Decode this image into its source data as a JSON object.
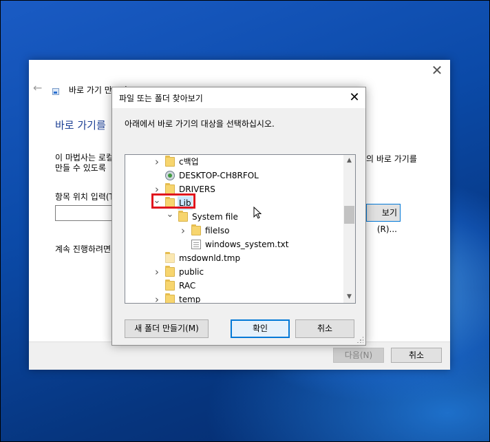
{
  "wizard": {
    "title": "바로 가기 만드기",
    "heading": "바로 가기를",
    "description_left": "이 마법사는 로컬 또는 네트워크 프로그램, 파일, 폴더, 컴퓨터 또는 인터넷 주소에 대한 바로 가기를 만들 수 있도록",
    "description_line2": "만들 수 있도록",
    "description_right": "의 바로 가기를",
    "location_label": "항목 위치 입력(T):",
    "location_value": "",
    "browse_label": "보기(R)...",
    "continue_text": "계속 진행하려면 [다음]을 클릭하십시오.",
    "next_label": "다음(N)",
    "cancel_label": "취소"
  },
  "dialog": {
    "title": "파일 또는 폴더 찾아보기",
    "instruction": "아래에서 바로 가기의 대상을 선택하십시오.",
    "tree": [
      {
        "label": "c백업",
        "icon": "folder-icon",
        "expander": "collapsed",
        "level": 0
      },
      {
        "label": "DESKTOP-CH8RFOL",
        "icon": "computer-icon",
        "expander": "none",
        "level": 0
      },
      {
        "label": "DRIVERS",
        "icon": "folder-icon",
        "expander": "collapsed",
        "level": 0
      },
      {
        "label": "Lib",
        "icon": "folder-icon",
        "expander": "expanded",
        "level": 0,
        "selected": true
      },
      {
        "label": "System file",
        "icon": "folder-icon",
        "expander": "expanded",
        "level": 1
      },
      {
        "label": "fileIso",
        "icon": "folder-icon",
        "expander": "collapsed",
        "level": 2
      },
      {
        "label": "windows_system.txt",
        "icon": "file-icon",
        "expander": "none",
        "level": 2
      },
      {
        "label": "msdownld.tmp",
        "icon": "folder-pale-icon",
        "expander": "none",
        "level": 0
      },
      {
        "label": "public",
        "icon": "folder-icon",
        "expander": "collapsed",
        "level": 0
      },
      {
        "label": "RAC",
        "icon": "folder-icon",
        "expander": "none",
        "level": 0
      },
      {
        "label": "temp",
        "icon": "folder-icon",
        "expander": "collapsed",
        "level": 0
      }
    ],
    "new_folder_label": "새 폴더 만들기(M)",
    "ok_label": "확인",
    "cancel_label": "취소"
  },
  "colors": {
    "highlight_box": "#e0141e",
    "selection": "#cce8ff",
    "ok_border": "#0078d7",
    "heading": "#1c3f94"
  }
}
